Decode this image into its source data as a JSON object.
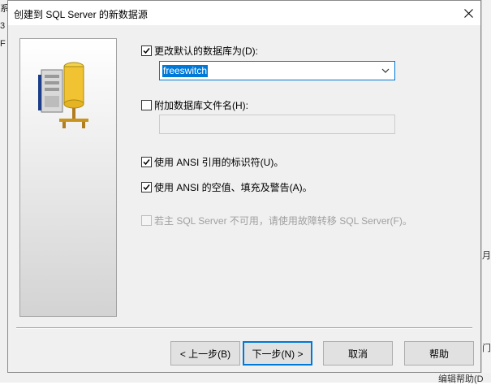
{
  "background": {
    "left_chars": [
      "系",
      "3",
      "F"
    ],
    "right_chars": [
      "月",
      "门"
    ],
    "bottom_text": "编辑帮助(D"
  },
  "dialog": {
    "title": "创建到 SQL Server 的新数据源",
    "change_default_db_label": "更改默认的数据库为(D):",
    "change_default_db_checked": true,
    "database_value": "freeswitch",
    "attach_db_label": "附加数据库文件名(H):",
    "attach_db_checked": false,
    "attach_db_value": "",
    "ansi_quoted_label": "使用 ANSI 引用的标识符(U)。",
    "ansi_quoted_checked": true,
    "ansi_nulls_label": "使用 ANSI 的空值、填充及警告(A)。",
    "ansi_nulls_checked": true,
    "failover_label": "若主 SQL Server 不可用，请使用故障转移 SQL Server(F)。",
    "failover_checked": false
  },
  "buttons": {
    "back": "< 上一步(B)",
    "next": "下一步(N) >",
    "cancel": "取消",
    "help": "帮助"
  },
  "icons": [
    "close-icon",
    "server-icon",
    "checkbox-check-icon",
    "chevron-down-icon"
  ]
}
